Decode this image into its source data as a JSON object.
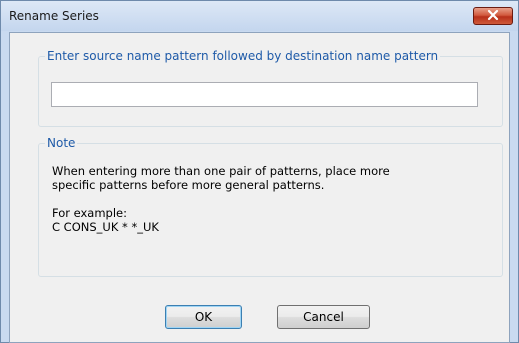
{
  "window": {
    "title": "Rename Series",
    "close_icon": "close-x-icon",
    "close_color": "#c7432a"
  },
  "pattern_group": {
    "legend": "Enter source name pattern followed by destination name pattern",
    "input_value": "",
    "input_placeholder": ""
  },
  "note_group": {
    "legend": "Note",
    "paragraph": "When entering more than one pair of patterns, place more\nspecific patterns before more general patterns.",
    "example_heading": "For example:",
    "example_value": "C CONS_UK * *_UK"
  },
  "buttons": {
    "ok_label": "OK",
    "cancel_label": "Cancel"
  },
  "colors": {
    "legend_text": "#1e5aa8",
    "window_frame": "#c9daf0"
  }
}
